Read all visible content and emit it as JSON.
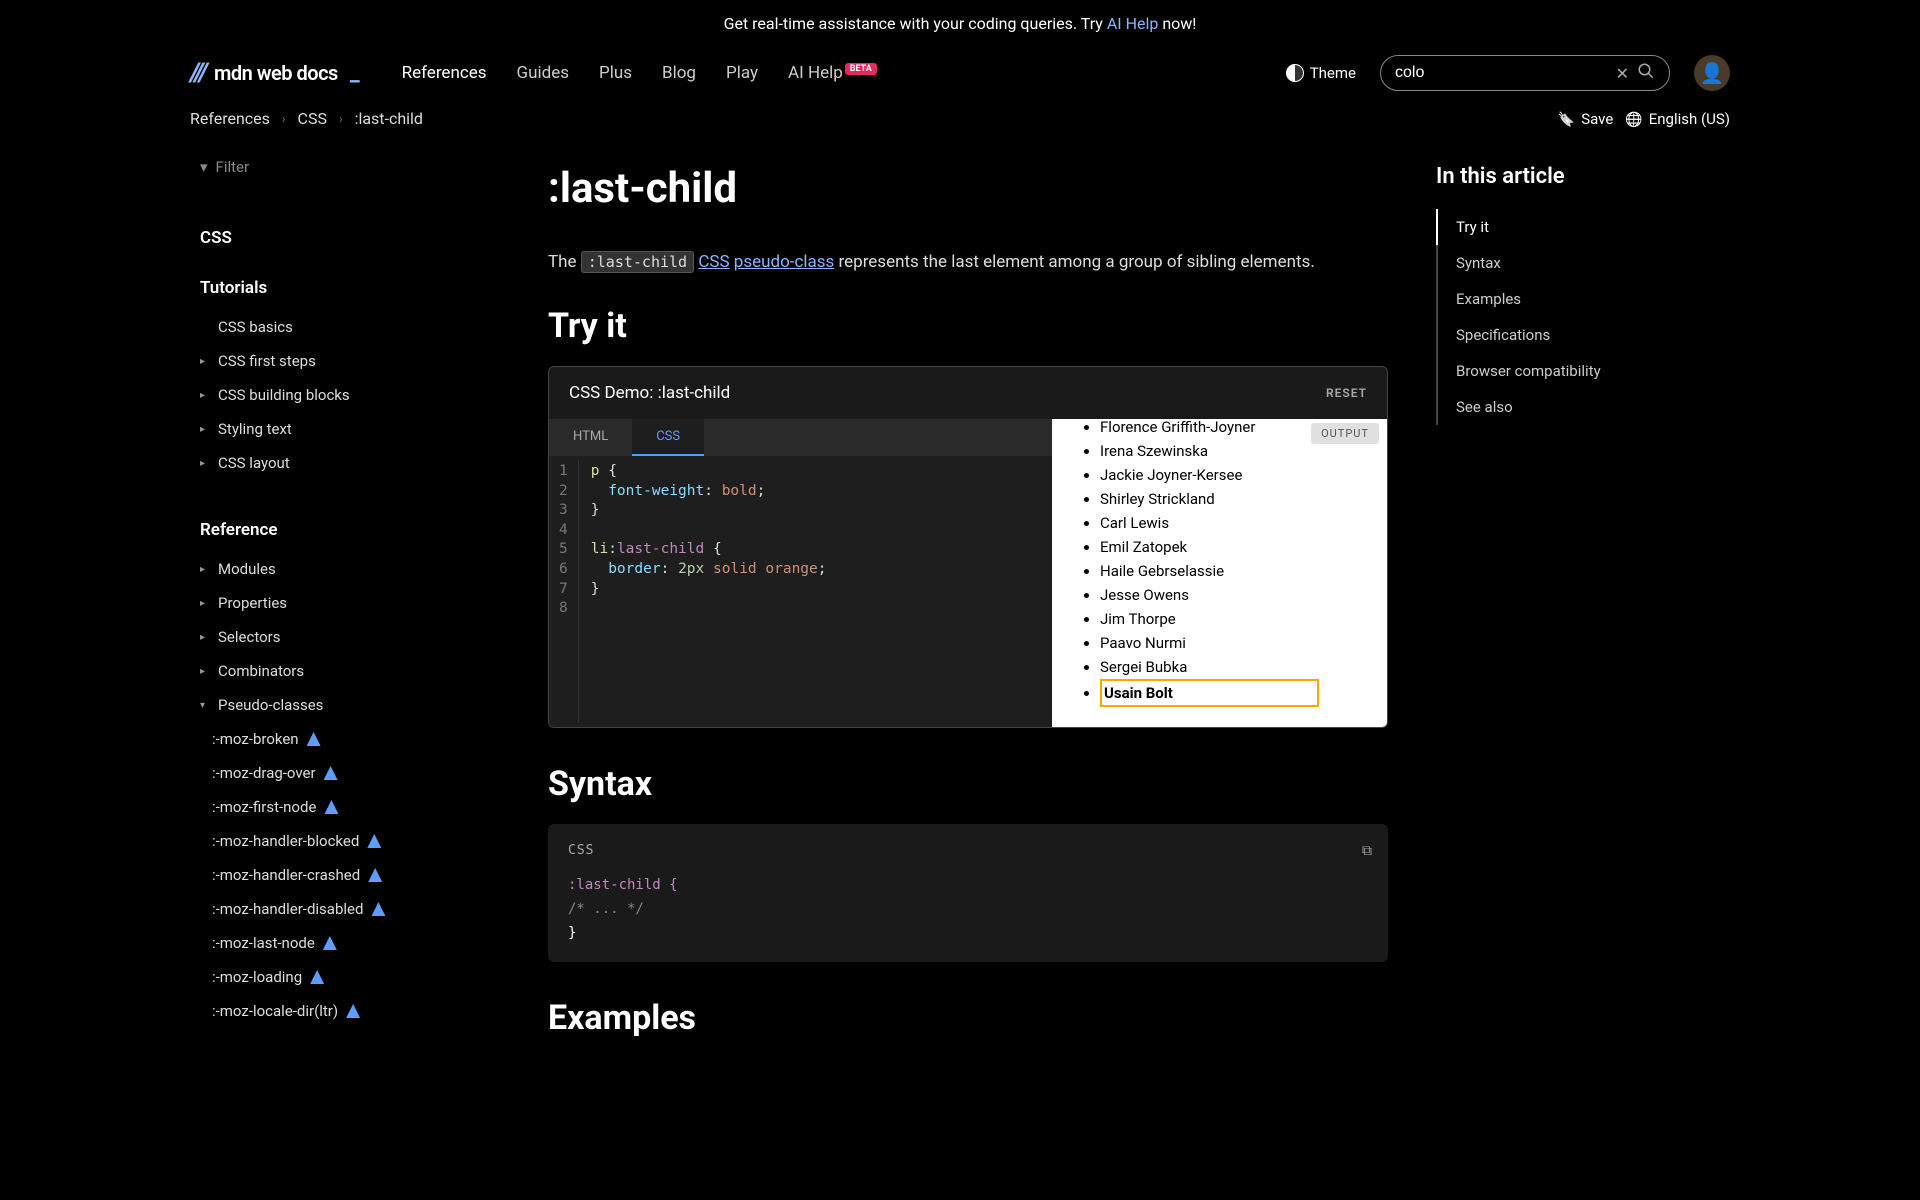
{
  "banner": {
    "prefix": "Get real-time assistance with your coding queries. Try ",
    "link": "AI Help",
    "suffix": " now!"
  },
  "logo": {
    "mark": "///",
    "text": "mdn web docs",
    "underscore": "_"
  },
  "nav": {
    "references": "References",
    "guides": "Guides",
    "plus": "Plus",
    "blog": "Blog",
    "play": "Play",
    "aihelp": "AI Help",
    "beta": "BETA"
  },
  "theme_label": "Theme",
  "search": {
    "value": "colo"
  },
  "breadcrumb": {
    "references": "References",
    "css": "CSS",
    "page": ":last-child"
  },
  "save_label": "Save",
  "language_label": "English (US)",
  "sidebar": {
    "filter_placeholder": "Filter",
    "css_label": "CSS",
    "tutorials_label": "Tutorials",
    "tutorials": {
      "basics": "CSS basics",
      "first_steps": "CSS first steps",
      "building_blocks": "CSS building blocks",
      "styling_text": "Styling text",
      "layout": "CSS layout"
    },
    "reference_label": "Reference",
    "reference": {
      "modules": "Modules",
      "properties": "Properties",
      "selectors": "Selectors",
      "combinators": "Combinators",
      "pseudo_classes": "Pseudo-classes"
    },
    "pseudo_items": [
      ":-moz-broken",
      ":-moz-drag-over",
      ":-moz-first-node",
      ":-moz-handler-blocked",
      ":-moz-handler-crashed",
      ":-moz-handler-disabled",
      ":-moz-last-node",
      ":-moz-loading",
      ":-moz-locale-dir(ltr)"
    ]
  },
  "page_title": ":last-child",
  "description": {
    "prefix": "The ",
    "code": ":last-child",
    "mid1": " ",
    "link1": "CSS",
    "mid2": " ",
    "link2": "pseudo-class",
    "suffix": " represents the last element among a group of sibling elements."
  },
  "h_tryit": "Try it",
  "demo": {
    "title": "CSS Demo: :last-child",
    "reset": "RESET",
    "tab_html": "HTML",
    "tab_css": "CSS",
    "output_label": "OUTPUT",
    "line_nums": [
      "1",
      "2",
      "3",
      "4",
      "5",
      "6",
      "7",
      "8"
    ],
    "athletes": [
      "Florence Griffith-Joyner",
      "Irena Szewinska",
      "Jackie Joyner-Kersee",
      "Shirley Strickland",
      "Carl Lewis",
      "Emil Zatopek",
      "Haile Gebrselassie",
      "Jesse Owens",
      "Jim Thorpe",
      "Paavo Nurmi",
      "Sergei Bubka",
      "Usain Bolt"
    ]
  },
  "h_syntax": "Syntax",
  "syntax_label": "CSS",
  "syntax_code": {
    "line1": ":last-child {",
    "line2": "  /* ... */",
    "line3": "}"
  },
  "h_examples": "Examples",
  "toc": {
    "title": "In this article",
    "items": [
      "Try it",
      "Syntax",
      "Examples",
      "Specifications",
      "Browser compatibility",
      "See also"
    ]
  }
}
